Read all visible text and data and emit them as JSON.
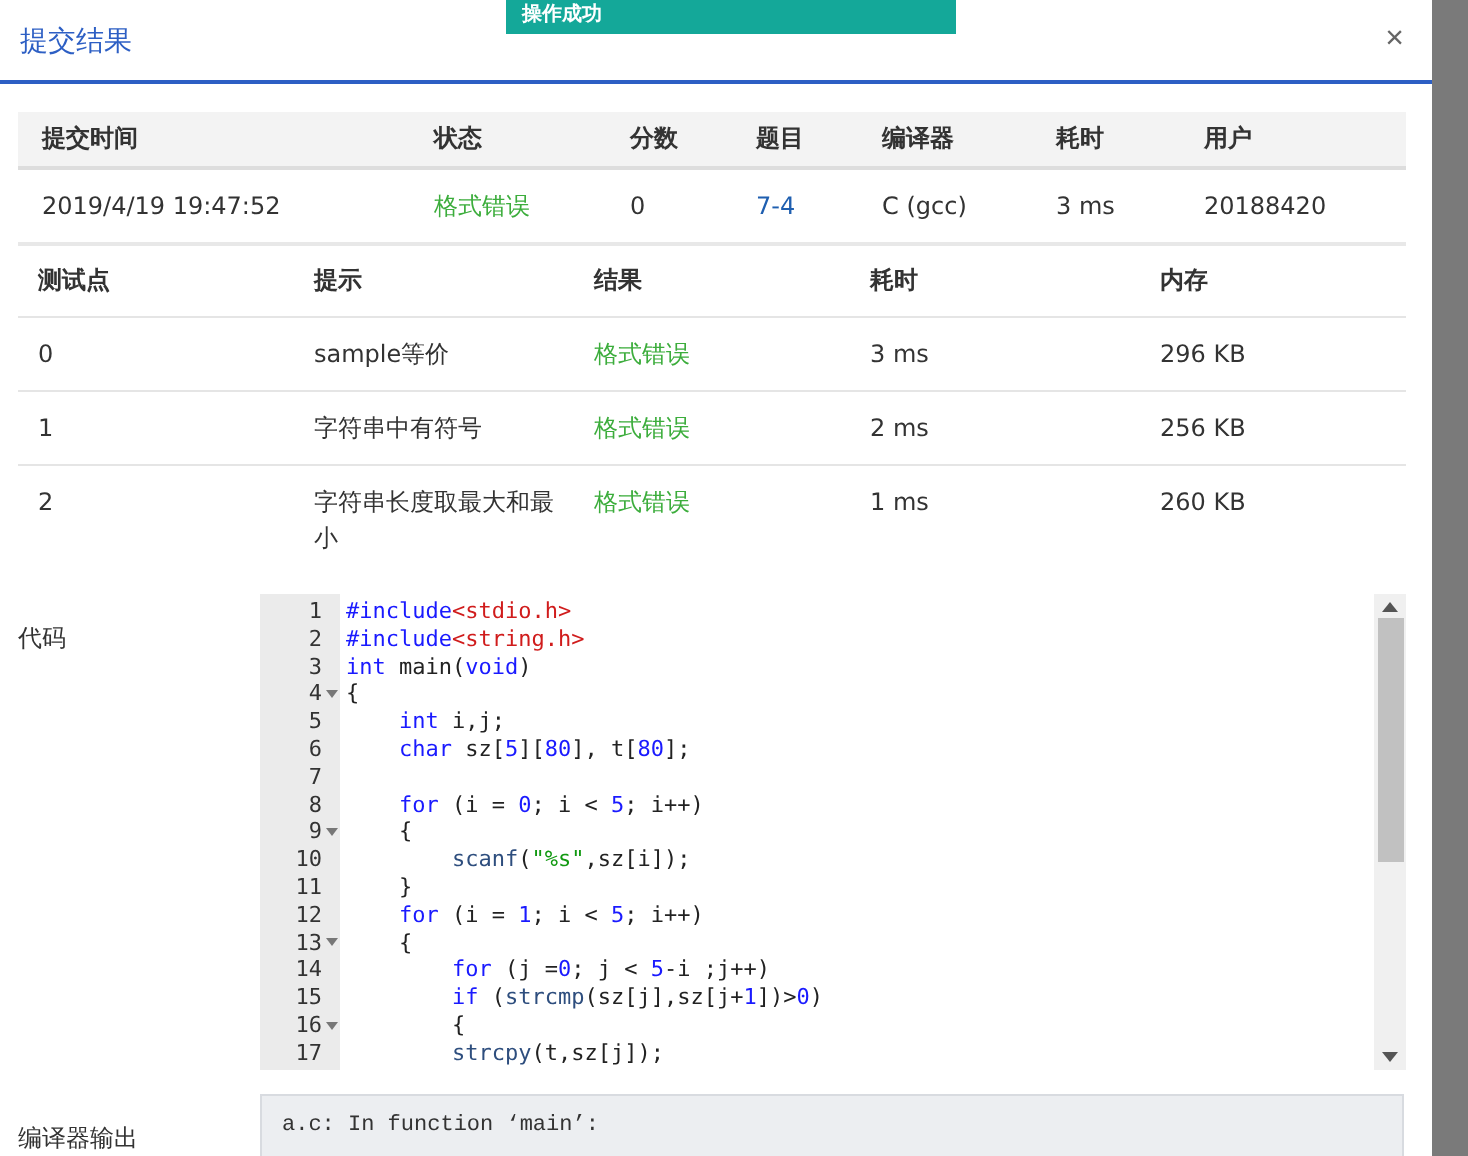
{
  "toast": {
    "text": "操作成功"
  },
  "dialog": {
    "title": "提交结果",
    "close": "×"
  },
  "summary": {
    "columns": [
      "提交时间",
      "状态",
      "分数",
      "题目",
      "编译器",
      "耗时",
      "用户"
    ],
    "row": {
      "time": "2019/4/19 19:47:52",
      "status": "格式错误",
      "score": "0",
      "problem": "7-4",
      "compiler": "C (gcc)",
      "duration": "3 ms",
      "user": "20188420"
    }
  },
  "tests": {
    "columns": [
      "测试点",
      "提示",
      "结果",
      "耗时",
      "内存"
    ],
    "rows": [
      {
        "id": "0",
        "hint": "sample等价",
        "result": "格式错误",
        "duration": "3 ms",
        "memory": "296 KB"
      },
      {
        "id": "1",
        "hint": "字符串中有符号",
        "result": "格式错误",
        "duration": "2 ms",
        "memory": "256 KB"
      },
      {
        "id": "2",
        "hint": "字符串长度取最大和最小",
        "result": "格式错误",
        "duration": "1 ms",
        "memory": "260 KB"
      }
    ]
  },
  "code": {
    "label": "代码",
    "lines": [
      {
        "n": "1",
        "fold": false,
        "tokens": [
          {
            "kind": "keyword",
            "text": "#include"
          },
          {
            "kind": "string",
            "text": "<stdio.h>"
          }
        ]
      },
      {
        "n": "2",
        "fold": false,
        "tokens": [
          {
            "kind": "keyword",
            "text": "#include"
          },
          {
            "kind": "string",
            "text": "<string.h>"
          }
        ]
      },
      {
        "n": "3",
        "fold": false,
        "tokens": [
          {
            "kind": "keyword",
            "text": "int"
          },
          {
            "kind": "plain",
            "text": " main("
          },
          {
            "kind": "keyword",
            "text": "void"
          },
          {
            "kind": "plain",
            "text": ")"
          }
        ]
      },
      {
        "n": "4",
        "fold": true,
        "tokens": [
          {
            "kind": "plain",
            "text": "{"
          }
        ]
      },
      {
        "n": "5",
        "fold": false,
        "tokens": [
          {
            "kind": "keyword",
            "text": "    int"
          },
          {
            "kind": "plain",
            "text": " i,j;"
          }
        ]
      },
      {
        "n": "6",
        "fold": false,
        "tokens": [
          {
            "kind": "keyword",
            "text": "    char"
          },
          {
            "kind": "plain",
            "text": " sz["
          },
          {
            "kind": "number",
            "text": "5"
          },
          {
            "kind": "plain",
            "text": "]["
          },
          {
            "kind": "number",
            "text": "80"
          },
          {
            "kind": "plain",
            "text": "], t["
          },
          {
            "kind": "number",
            "text": "80"
          },
          {
            "kind": "plain",
            "text": "];"
          }
        ]
      },
      {
        "n": "7",
        "fold": false
      },
      {
        "n": "8",
        "fold": false,
        "tokens": [
          {
            "kind": "keyword",
            "text": "    for"
          },
          {
            "kind": "plain",
            "text": " (i = "
          },
          {
            "kind": "number",
            "text": "0"
          },
          {
            "kind": "plain",
            "text": "; i < "
          },
          {
            "kind": "number",
            "text": "5"
          },
          {
            "kind": "plain",
            "text": "; i++)"
          }
        ]
      },
      {
        "n": "9",
        "fold": true,
        "tokens": [
          {
            "kind": "plain",
            "text": "    {"
          }
        ]
      },
      {
        "n": "10",
        "fold": false,
        "tokens": [
          {
            "kind": "function",
            "text": "        scanf"
          },
          {
            "kind": "plain",
            "text": "("
          },
          {
            "kind": "literal",
            "text": "\"%s\""
          },
          {
            "kind": "plain",
            "text": ",sz[i]);"
          }
        ]
      },
      {
        "n": "11",
        "fold": false,
        "tokens": [
          {
            "kind": "plain",
            "text": "    }"
          }
        ]
      },
      {
        "n": "12",
        "fold": false,
        "tokens": [
          {
            "kind": "keyword",
            "text": "    for"
          },
          {
            "kind": "plain",
            "text": " (i = "
          },
          {
            "kind": "number",
            "text": "1"
          },
          {
            "kind": "plain",
            "text": "; i < "
          },
          {
            "kind": "number",
            "text": "5"
          },
          {
            "kind": "plain",
            "text": "; i++)"
          }
        ]
      },
      {
        "n": "13",
        "fold": true,
        "tokens": [
          {
            "kind": "plain",
            "text": "    {"
          }
        ]
      },
      {
        "n": "14",
        "fold": false,
        "tokens": [
          {
            "kind": "keyword",
            "text": "        for"
          },
          {
            "kind": "plain",
            "text": " (j ="
          },
          {
            "kind": "number",
            "text": "0"
          },
          {
            "kind": "plain",
            "text": "; j < "
          },
          {
            "kind": "number",
            "text": "5"
          },
          {
            "kind": "plain",
            "text": "-i ;j++)"
          }
        ]
      },
      {
        "n": "15",
        "fold": false,
        "tokens": [
          {
            "kind": "keyword",
            "text": "        if"
          },
          {
            "kind": "plain",
            "text": " ("
          },
          {
            "kind": "function",
            "text": "strcmp"
          },
          {
            "kind": "plain",
            "text": "(sz[j],sz[j+"
          },
          {
            "kind": "number",
            "text": "1"
          },
          {
            "kind": "plain",
            "text": "])>"
          },
          {
            "kind": "number",
            "text": "0"
          },
          {
            "kind": "plain",
            "text": ")"
          }
        ]
      },
      {
        "n": "16",
        "fold": true,
        "tokens": [
          {
            "kind": "plain",
            "text": "        {"
          }
        ]
      },
      {
        "n": "17",
        "fold": false,
        "tokens": [
          {
            "kind": "function",
            "text": "        strcpy"
          },
          {
            "kind": "plain",
            "text": "(t,sz[j]);"
          }
        ]
      }
    ]
  },
  "compiler_output": {
    "label": "编译器输出",
    "lines": [
      "a.c: In function ‘main’:"
    ]
  }
}
